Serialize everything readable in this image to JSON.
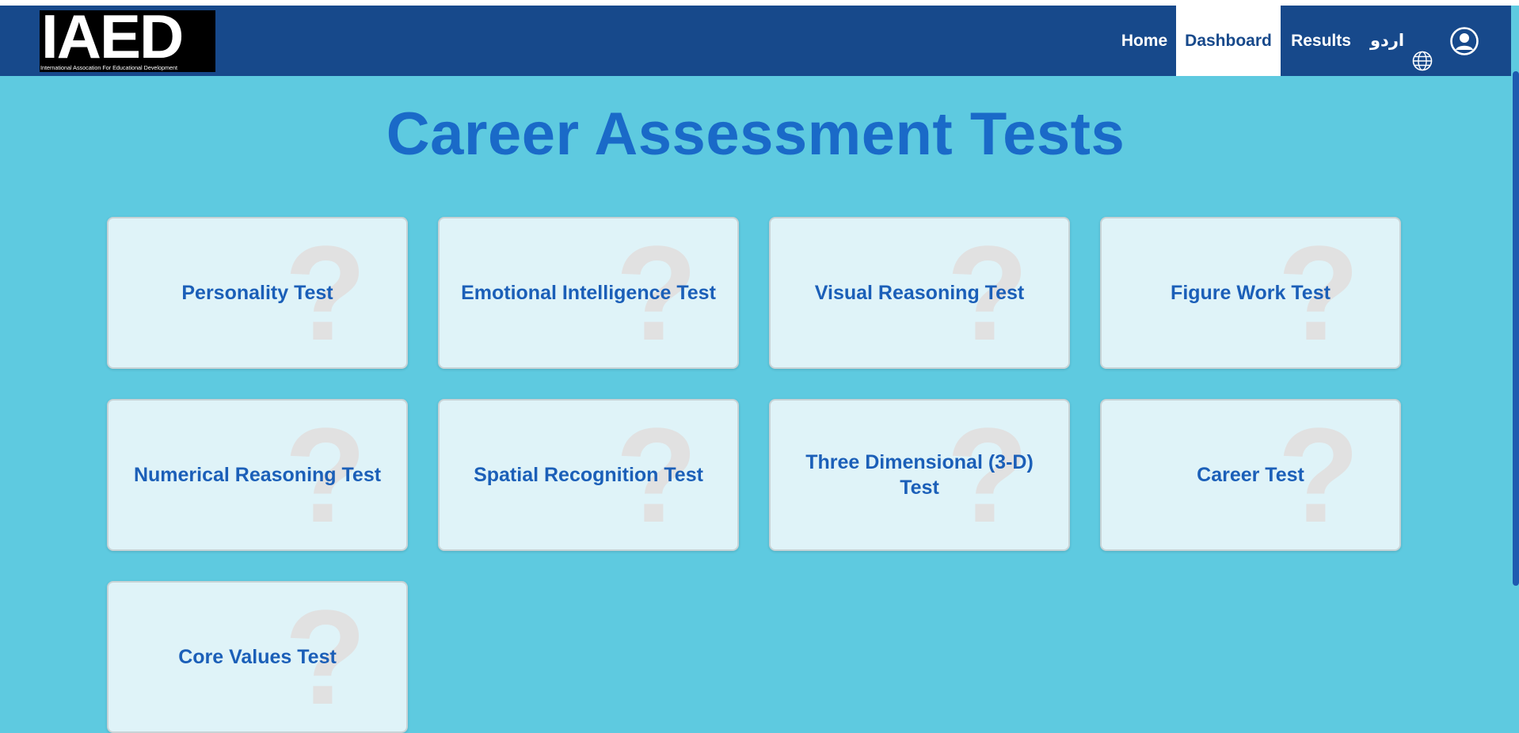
{
  "logo": {
    "text": "IAED",
    "subtitle": "International Assocation For Educational Development"
  },
  "nav": {
    "home": "Home",
    "dashboard": "Dashboard",
    "results": "Results",
    "language": "اردو",
    "icons": {
      "language": "globe-icon",
      "account": "user-circle-icon"
    },
    "colors": {
      "bar": "#17498b",
      "active_bg": "#ffffff",
      "active_text": "#17498b"
    }
  },
  "page": {
    "title": "Career Assessment Tests",
    "background": "#5ecae0",
    "title_color": "#1a6ac8"
  },
  "tests": [
    {
      "label": "Personality Test",
      "icon": "question-mark-icon"
    },
    {
      "label": "Emotional Intelligence Test",
      "icon": "question-mark-icon"
    },
    {
      "label": "Visual Reasoning Test",
      "icon": "question-mark-icon"
    },
    {
      "label": "Figure Work Test",
      "icon": "question-mark-icon"
    },
    {
      "label": "Numerical Reasoning Test",
      "icon": "question-mark-icon"
    },
    {
      "label": "Spatial Recognition Test",
      "icon": "question-mark-icon"
    },
    {
      "label": "Three Dimensional (3-D) Test",
      "icon": "question-mark-icon"
    },
    {
      "label": "Career Test",
      "icon": "question-mark-icon"
    },
    {
      "label": "Core Values Test",
      "icon": "question-mark-icon"
    }
  ]
}
